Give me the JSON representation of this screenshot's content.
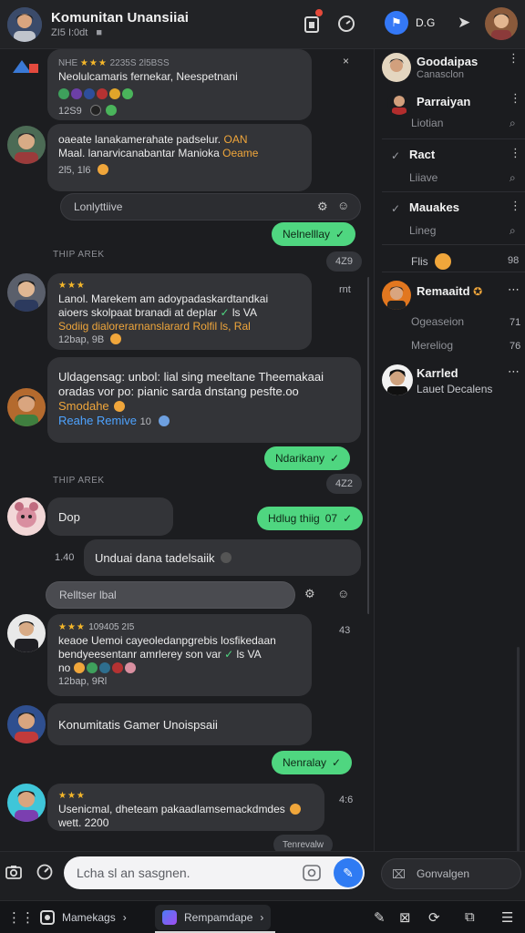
{
  "topbar": {
    "title": "Komunitan Unansiiai",
    "subtitle": "ZI5 I:0dt",
    "right_label": "D.G"
  },
  "chat": {
    "messages": [
      {
        "header": "NHE",
        "time": "2235S 2l5BSS",
        "text1": "Neolulcamaris fernekar, Neespetnani",
        "time2": "12S9"
      },
      {
        "text1": "oaeate lanakamerahate padselur.",
        "hl": "OAN",
        "text2": "Maal. lanarvicanabantar Manioka",
        "hl2": "Oeame",
        "meta": "2l5, 1l6"
      },
      {
        "reply": "Lonlyttiive",
        "pill": "Nelnelllay",
        "chip": "4Z9"
      },
      {
        "section": "THIP AREK"
      },
      {
        "text1": "Lanol. Marekem am adoypadaskardtandkai",
        "text2": "aioers skolpaat branadi at deplar",
        "hl2": "ls VA",
        "text3": "Sodiig dialorerarnanslarard",
        "hl3": "Rolfil ls, Ral",
        "meta": "12bap, 9B",
        "side": "rnt"
      },
      {
        "text1": "Uldagensag: unbol: lial sing meeltane Theemakaai",
        "text2": "oradas vor po: pianic sarda dnstang pesfte.oo",
        "hl": "Smodahe",
        "link": "Reahe Remive",
        "meta": "10",
        "pill": "Ndarikany",
        "chip": "4Z2"
      },
      {
        "section": "THIP AREK"
      },
      {
        "text1": "Dop",
        "pill": "Hdlug thiig",
        "pill_num": "07"
      },
      {
        "time": "1.40",
        "text1": "Unduai dana tadelsaiik"
      },
      {
        "reply": "Relltser lbal"
      },
      {
        "text1": "keaoe Uemoi cayeoledanpgrebis losfikedaan",
        "text2": "bendyeesentanr amrlerey son var",
        "hl2": "ls VA",
        "text3": "no",
        "meta": "12bap, 9Rl",
        "side": "43",
        "time": "109405 2I5"
      },
      {
        "text1": "Konumitatis Gamer Unoispsaii",
        "pill": "Nenralay"
      },
      {
        "text1": "Usenicmal, dheteam pakaadlamsemackdmdes",
        "text2": "wett. 2200",
        "side": "4:6",
        "tail": "Tenrevalw"
      }
    ]
  },
  "right_panel": {
    "items": [
      {
        "name": "Goodaipas",
        "sub": "Canasclon"
      },
      {
        "name": "Parraiyan",
        "sub": "Liotian"
      },
      {
        "name": "Ract",
        "sub": "Liiave"
      },
      {
        "name": "Mauakes",
        "sub": "Lineg"
      },
      {
        "name": "Flis",
        "num": "98"
      },
      {
        "name": "Remaaitd",
        "sub": "Ogeaseion",
        "num": "71",
        "sub2": "Mereliog",
        "num2": "76"
      },
      {
        "name": "Karrled",
        "sub": "Lauet Decalens"
      }
    ]
  },
  "composer": {
    "placeholder": "Lcha sl an sasgnen.",
    "right_placeholder": "Gonvalgen"
  },
  "bottombar": {
    "tab1": "Mamekags",
    "tab2": "Rempamdape"
  },
  "colors": {
    "accent_green": "#4fd680",
    "accent_blue": "#2f7bf3",
    "star": "#f5b72a",
    "bg": "#1c1d20"
  }
}
